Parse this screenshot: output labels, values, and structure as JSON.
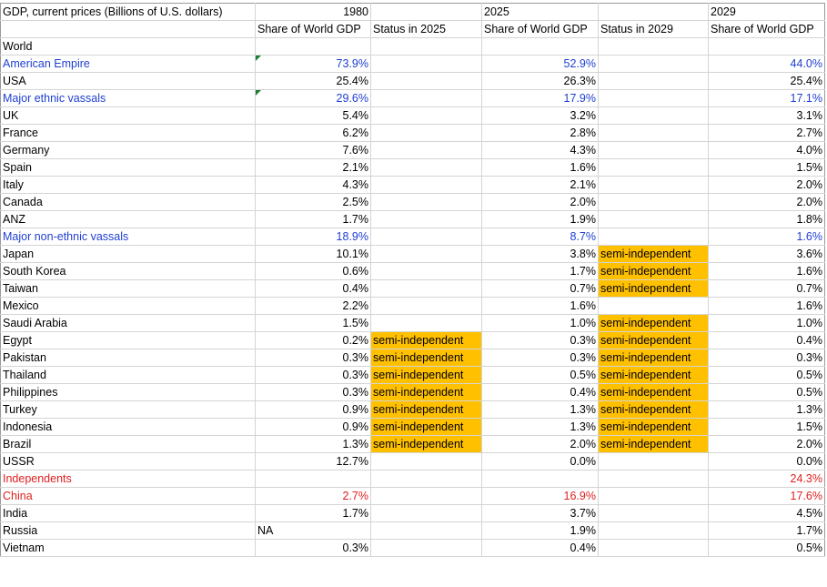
{
  "header": {
    "title": "GDP, current prices (Billions of U.S. dollars)",
    "year_1980": "1980",
    "year_2025": "2025",
    "year_2029": "2029",
    "col_share_1980": "Share of World GDP",
    "col_status_2025": "Status in 2025",
    "col_share_2025": "Share of World GDP",
    "col_status_2029": "Status in 2029",
    "col_share_2029": "Share of World GDP"
  },
  "colors": {
    "group_blue": "#1f3fd2",
    "group_red": "#e02020",
    "highlight": "#ffc000",
    "comment_marker": "#1e7e34"
  },
  "rows": [
    {
      "name": "World",
      "style": "normal",
      "s1980": "",
      "st2025": "",
      "s2025": "",
      "st2029": "",
      "s2029": ""
    },
    {
      "name": "American Empire",
      "style": "blue",
      "s1980": "73.9%",
      "st2025": "",
      "s2025": "52.9%",
      "st2029": "",
      "s2029": "44.0%",
      "marker": true
    },
    {
      "name": "USA",
      "style": "normal",
      "s1980": "25.4%",
      "st2025": "",
      "s2025": "26.3%",
      "st2029": "",
      "s2029": "25.4%"
    },
    {
      "name": "Major ethnic vassals",
      "style": "blue",
      "s1980": "29.6%",
      "st2025": "",
      "s2025": "17.9%",
      "st2029": "",
      "s2029": "17.1%",
      "marker": true
    },
    {
      "name": "UK",
      "style": "normal",
      "s1980": "5.4%",
      "st2025": "",
      "s2025": "3.2%",
      "st2029": "",
      "s2029": "3.1%"
    },
    {
      "name": "France",
      "style": "normal",
      "s1980": "6.2%",
      "st2025": "",
      "s2025": "2.8%",
      "st2029": "",
      "s2029": "2.7%"
    },
    {
      "name": "Germany",
      "style": "normal",
      "s1980": "7.6%",
      "st2025": "",
      "s2025": "4.3%",
      "st2029": "",
      "s2029": "4.0%"
    },
    {
      "name": "Spain",
      "style": "normal",
      "s1980": "2.1%",
      "st2025": "",
      "s2025": "1.6%",
      "st2029": "",
      "s2029": "1.5%"
    },
    {
      "name": "Italy",
      "style": "normal",
      "s1980": "4.3%",
      "st2025": "",
      "s2025": "2.1%",
      "st2029": "",
      "s2029": "2.0%"
    },
    {
      "name": "Canada",
      "style": "normal",
      "s1980": "2.5%",
      "st2025": "",
      "s2025": "2.0%",
      "st2029": "",
      "s2029": "2.0%"
    },
    {
      "name": "ANZ",
      "style": "normal",
      "s1980": "1.7%",
      "st2025": "",
      "s2025": "1.9%",
      "st2029": "",
      "s2029": "1.8%"
    },
    {
      "name": "Major non-ethnic vassals",
      "style": "blue",
      "s1980": "18.9%",
      "st2025": "",
      "s2025": "8.7%",
      "st2029": "",
      "s2029": "1.6%"
    },
    {
      "name": "Japan",
      "style": "normal",
      "s1980": "10.1%",
      "st2025": "",
      "s2025": "3.8%",
      "st2029": "semi-independent",
      "s2029": "3.6%"
    },
    {
      "name": "South Korea",
      "style": "normal",
      "s1980": "0.6%",
      "st2025": "",
      "s2025": "1.7%",
      "st2029": "semi-independent",
      "s2029": "1.6%"
    },
    {
      "name": "Taiwan",
      "style": "normal",
      "s1980": "0.4%",
      "st2025": "",
      "s2025": "0.7%",
      "st2029": "semi-independent",
      "s2029": "0.7%"
    },
    {
      "name": "Mexico",
      "style": "normal",
      "s1980": "2.2%",
      "st2025": "",
      "s2025": "1.6%",
      "st2029": "",
      "s2029": "1.6%"
    },
    {
      "name": "Saudi Arabia",
      "style": "normal",
      "s1980": "1.5%",
      "st2025": "",
      "s2025": "1.0%",
      "st2029": "semi-independent",
      "s2029": "1.0%"
    },
    {
      "name": "Egypt",
      "style": "normal",
      "s1980": "0.2%",
      "st2025": "semi-independent",
      "s2025": "0.3%",
      "st2029": "semi-independent",
      "s2029": "0.4%"
    },
    {
      "name": "Pakistan",
      "style": "normal",
      "s1980": "0.3%",
      "st2025": "semi-independent",
      "s2025": "0.3%",
      "st2029": "semi-independent",
      "s2029": "0.3%"
    },
    {
      "name": "Thailand",
      "style": "normal",
      "s1980": "0.3%",
      "st2025": "semi-independent",
      "s2025": "0.5%",
      "st2029": "semi-independent",
      "s2029": "0.5%"
    },
    {
      "name": "Philippines",
      "style": "normal",
      "s1980": "0.3%",
      "st2025": "semi-independent",
      "s2025": "0.4%",
      "st2029": "semi-independent",
      "s2029": "0.5%"
    },
    {
      "name": "Turkey",
      "style": "normal",
      "s1980": "0.9%",
      "st2025": "semi-independent",
      "s2025": "1.3%",
      "st2029": "semi-independent",
      "s2029": "1.3%"
    },
    {
      "name": "Indonesia",
      "style": "normal",
      "s1980": "0.9%",
      "st2025": "semi-independent",
      "s2025": "1.3%",
      "st2029": "semi-independent",
      "s2029": "1.5%"
    },
    {
      "name": "Brazil",
      "style": "normal",
      "s1980": "1.3%",
      "st2025": "semi-independent",
      "s2025": "2.0%",
      "st2029": "semi-independent",
      "s2029": "2.0%"
    },
    {
      "name": "USSR",
      "style": "normal",
      "s1980": "12.7%",
      "st2025": "",
      "s2025": "0.0%",
      "st2029": "",
      "s2029": "0.0%"
    },
    {
      "name": "Independents",
      "style": "red",
      "s1980": "",
      "st2025": "",
      "s2025": "",
      "st2029": "",
      "s2029": "24.3%"
    },
    {
      "name": "China",
      "style": "red",
      "s1980": "2.7%",
      "st2025": "",
      "s2025": "16.9%",
      "st2029": "",
      "s2029": "17.6%"
    },
    {
      "name": "India",
      "style": "normal",
      "s1980": "1.7%",
      "st2025": "",
      "s2025": "3.7%",
      "st2029": "",
      "s2029": "4.5%"
    },
    {
      "name": "Russia",
      "style": "normal",
      "s1980": "NA",
      "s1980_align": "left",
      "st2025": "",
      "s2025": "1.9%",
      "st2029": "",
      "s2029": "1.7%"
    },
    {
      "name": "Vietnam",
      "style": "normal",
      "s1980": "0.3%",
      "st2025": "",
      "s2025": "0.4%",
      "st2029": "",
      "s2029": "0.5%"
    }
  ]
}
